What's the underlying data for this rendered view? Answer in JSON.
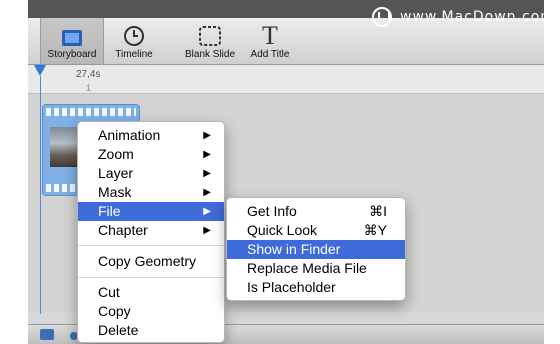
{
  "toolbar": {
    "storyboard_label": "Storyboard",
    "timeline_label": "Timeline",
    "blank_slide_label": "Blank Slide",
    "add_title_label": "Add Title",
    "add_title_glyph": "T"
  },
  "watermark": {
    "text": "www.MacDown.com"
  },
  "timeline": {
    "duration": "27,4s",
    "slide_number": "1"
  },
  "context_menu": {
    "items": [
      {
        "label": "Animation",
        "submenu": true
      },
      {
        "label": "Zoom",
        "submenu": true
      },
      {
        "label": "Layer",
        "submenu": true
      },
      {
        "label": "Mask",
        "submenu": true
      },
      {
        "label": "File",
        "submenu": true,
        "highlighted": true
      },
      {
        "label": "Chapter",
        "submenu": true
      },
      {
        "label": "Copy Geometry",
        "submenu": false
      },
      {
        "label": "Cut",
        "submenu": false
      },
      {
        "label": "Copy",
        "submenu": false
      },
      {
        "label": "Delete",
        "submenu": false
      }
    ],
    "arrow_glyph": "▶"
  },
  "file_submenu": {
    "items": [
      {
        "label": "Get Info",
        "shortcut": "⌘I"
      },
      {
        "label": "Quick Look",
        "shortcut": "⌘Y"
      },
      {
        "label": "Show in Finder",
        "shortcut": "",
        "highlighted": true
      },
      {
        "label": "Replace Media File",
        "shortcut": ""
      },
      {
        "label": "Is Placeholder",
        "shortcut": ""
      }
    ]
  },
  "colors": {
    "highlight": "#3e6bd9",
    "clip": "#7fb0e6",
    "playhead": "#2b7fdc"
  }
}
